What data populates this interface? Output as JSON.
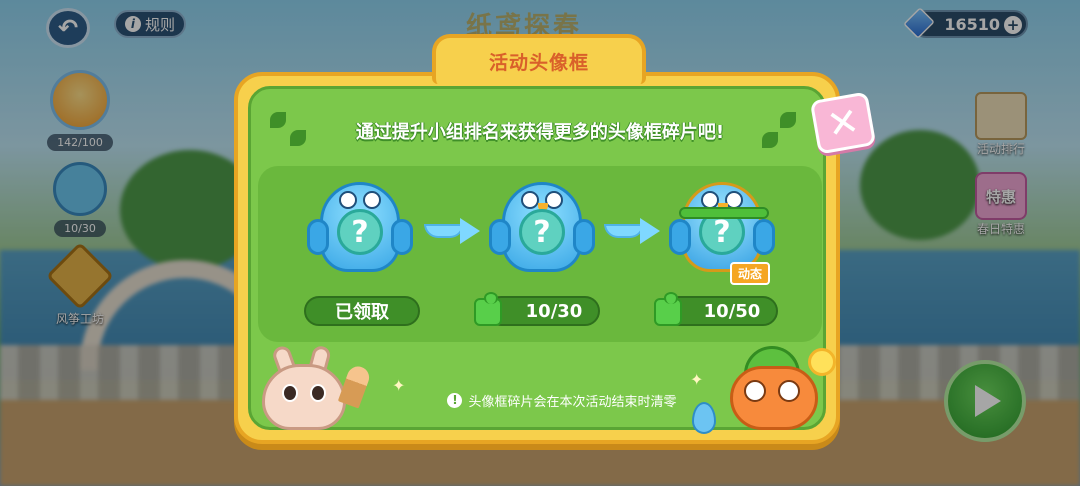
{
  "hud": {
    "back_icon": "back-arrow-icon",
    "rules_label": "规则",
    "title": "纸鸢探春",
    "currency_amount": "16510",
    "currency_icon": "gem-icon"
  },
  "left_sidebar": {
    "frame_progress": "142/100",
    "fragment_progress": "10/30",
    "kite_workshop_label": "风筝工坊"
  },
  "right_sidebar": {
    "ranking_label": "活动排行",
    "sale_badge": "特惠",
    "sale_label": "春日特惠"
  },
  "modal": {
    "title": "活动头像框",
    "subtitle": "通过提升小组排名来获得更多的头像框碎片吧!",
    "close_icon": "close-icon",
    "stages": [
      {
        "status": "已领取",
        "claimed": true
      },
      {
        "status": "10/30",
        "claimed": false
      },
      {
        "status": "10/50",
        "claimed": false,
        "tag": "动态"
      }
    ],
    "notice": "头像框碎片会在本次活动结束时清零"
  },
  "colors": {
    "modal_border": "#f7d04c",
    "modal_bg": "#7cc84b",
    "title_text": "#d9602a",
    "close_bg": "#f9b7d6"
  }
}
